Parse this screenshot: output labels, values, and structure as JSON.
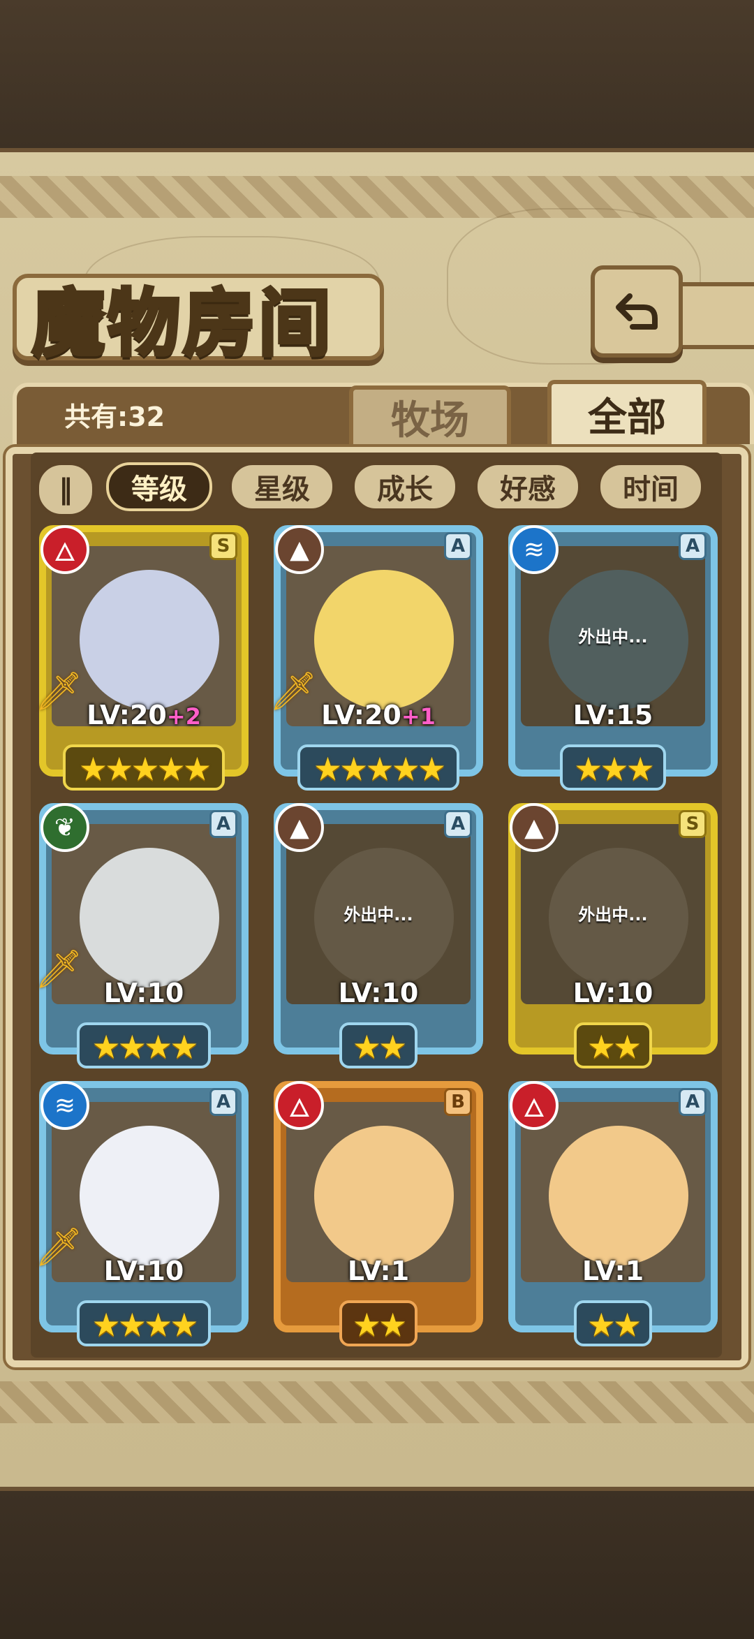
{
  "title": "魔物房间",
  "count_label": "共有:32",
  "tabs": {
    "ranch": "牧场",
    "all": "全部"
  },
  "sort": {
    "toggle_icon": "pause-icon",
    "buttons": [
      "等级",
      "星级",
      "成长",
      "好感",
      "时间"
    ],
    "active": "等级"
  },
  "away_label": "外出中...",
  "monsters": [
    {
      "element": "fire",
      "rank": "S",
      "frame": "gold",
      "level": "LV:20",
      "bonus": "+2",
      "stars": "★★★★★",
      "weapon": true,
      "away": false,
      "portrait": "#c9d0e6"
    },
    {
      "element": "earth",
      "rank": "A",
      "frame": "blue",
      "level": "LV:20",
      "bonus": "+1",
      "stars": "★★★★★",
      "weapon": true,
      "away": false,
      "portrait": "#f2d56a"
    },
    {
      "element": "water",
      "rank": "A",
      "frame": "blue",
      "level": "LV:15",
      "bonus": "",
      "stars": "★★★",
      "weapon": false,
      "away": true,
      "portrait": "#5f8aa0"
    },
    {
      "element": "wind",
      "rank": "A",
      "frame": "blue",
      "level": "LV:10",
      "bonus": "",
      "stars": "★★★★",
      "weapon": true,
      "away": false,
      "portrait": "#d9dcdc"
    },
    {
      "element": "earth",
      "rank": "A",
      "frame": "blue",
      "level": "LV:10",
      "bonus": "",
      "stars": "★★",
      "weapon": false,
      "away": true,
      "portrait": "#8a7d6a"
    },
    {
      "element": "earth",
      "rank": "S",
      "frame": "gold",
      "level": "LV:10",
      "bonus": "",
      "stars": "★★",
      "weapon": false,
      "away": true,
      "portrait": "#8a7d6a"
    },
    {
      "element": "water",
      "rank": "A",
      "frame": "blue",
      "level": "LV:10",
      "bonus": "",
      "stars": "★★★★",
      "weapon": true,
      "away": false,
      "portrait": "#eef0f6"
    },
    {
      "element": "fire",
      "rank": "B",
      "frame": "orange",
      "level": "LV:1",
      "bonus": "",
      "stars": "★★",
      "weapon": false,
      "away": false,
      "portrait": "#f2c98a"
    },
    {
      "element": "fire",
      "rank": "A",
      "frame": "blue",
      "level": "LV:1",
      "bonus": "",
      "stars": "★★",
      "weapon": false,
      "away": false,
      "portrait": "#f2c98a"
    }
  ]
}
